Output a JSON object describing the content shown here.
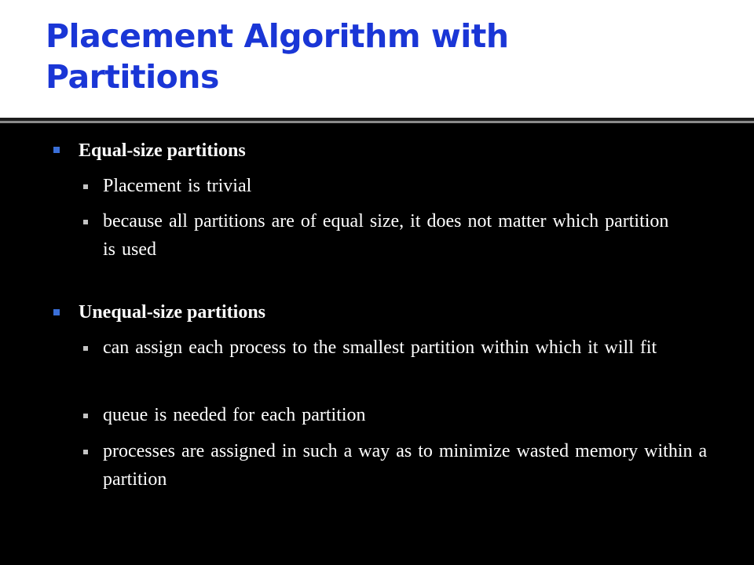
{
  "slide": {
    "title_line1": "Placement Algorithm with",
    "title_line2": "Partitions",
    "sections": [
      {
        "heading": "Equal-size partitions",
        "items": [
          "Placement is trivial",
          "because all partitions are of equal size, it does not matter which partition is used"
        ]
      },
      {
        "heading": "Unequal-size partitions",
        "items": [
          "can assign each process to the smallest partition within which it will fit",
          "queue is needed for each partition",
          "processes are assigned in such a way as to minimize wasted memory within a partition"
        ]
      }
    ]
  },
  "colors": {
    "title": "#1a36d6",
    "background": "#000000",
    "header_band": "#ffffff",
    "level1_bullet": "#3a6fd8",
    "level2_bullet": "#c4c4c4",
    "body_text": "#ffffff"
  },
  "icons": {
    "level1_bullet": "square-bullet-icon",
    "level2_bullet": "small-square-bullet-icon"
  }
}
